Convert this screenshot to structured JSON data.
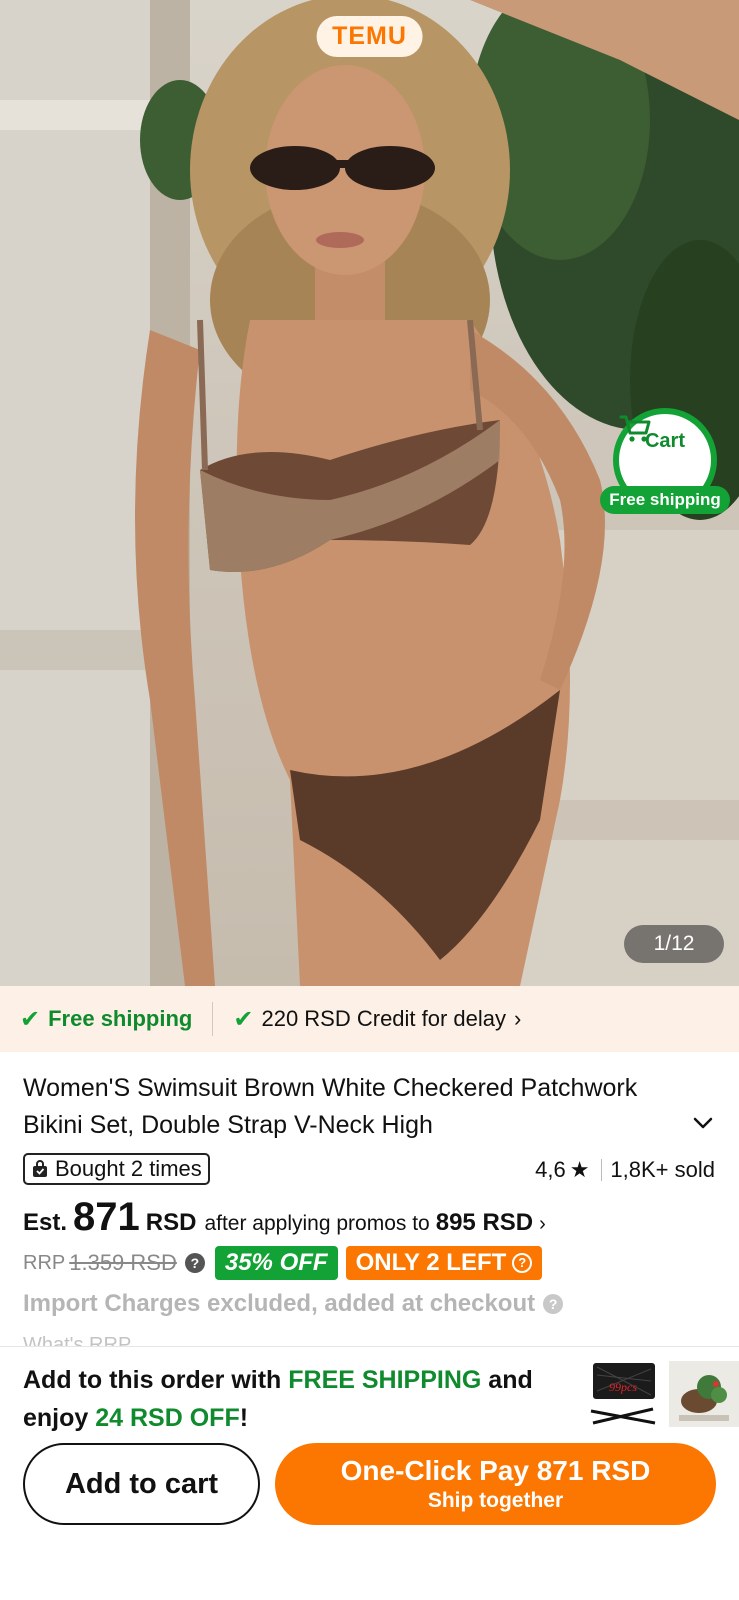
{
  "brand": {
    "logo_text": "TEMU"
  },
  "hero": {
    "image_counter": "1/12",
    "cart_fab": {
      "label": "Cart",
      "badge": "Free shipping"
    }
  },
  "shipping_banner": {
    "free_shipping": "Free shipping",
    "credit": "220 RSD Credit for delay"
  },
  "product": {
    "title": "Women'S Swimsuit Brown White Checkered Patchwork Bikini Set, Double Strap V-Neck High",
    "bought": "Bought 2 times",
    "rating": "4,6",
    "sold": "1,8K+ sold",
    "price": {
      "est_label": "Est.",
      "amount": "871",
      "currency": "RSD",
      "promo_text": "after applying promos to",
      "promo_price": "895 RSD"
    },
    "rrp": {
      "label": "RRP",
      "value": "1.359 RSD",
      "discount": "35% OFF",
      "stock": "ONLY 2 LEFT"
    },
    "import_note": "Import Charges excluded, added at checkout",
    "whats_rrp": "What's RRP"
  },
  "bottom": {
    "upsell": {
      "part1": "Add to this order with ",
      "free_shipping": "FREE SHIPPING",
      "part2": " and enjoy ",
      "discount": "24 RSD OFF",
      "part3": "!"
    },
    "thumb1_text": "99pcs",
    "add_to_cart": "Add to cart",
    "pay_main": "One-Click Pay 871 RSD",
    "pay_sub": "Ship together"
  },
  "colors": {
    "brand_orange": "#fb7701",
    "green": "#12a236",
    "dark_green_text": "#0f8a2d",
    "banner_bg": "#fdf0e6"
  },
  "icons": [
    "cart-icon",
    "check-icon",
    "chevron-right-icon",
    "chevron-down-icon",
    "shopping-bag-icon",
    "star-icon",
    "help-icon"
  ]
}
